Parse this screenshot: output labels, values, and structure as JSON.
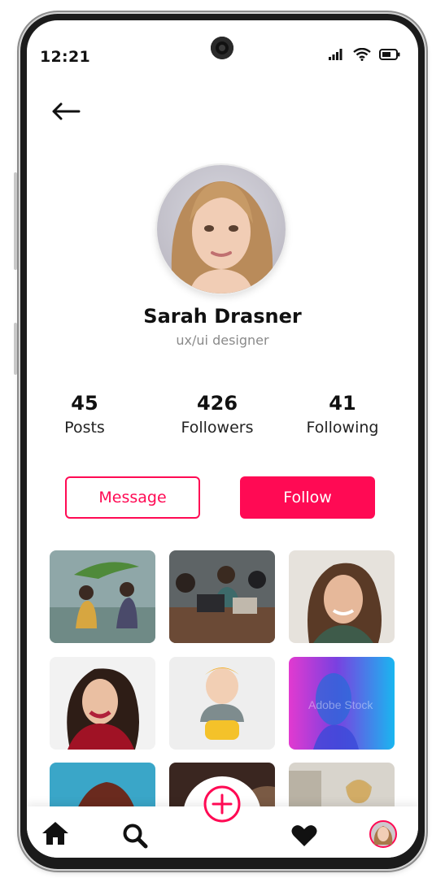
{
  "status_bar": {
    "time": "12:21",
    "icons": [
      "signal-icon",
      "wifi-icon",
      "battery-icon"
    ]
  },
  "header": {
    "back_icon": "arrow-left-icon"
  },
  "profile": {
    "name": "Sarah Drasner",
    "role": "ux/ui designer",
    "avatar_icon": "avatar"
  },
  "stats": [
    {
      "value": "45",
      "label": "Posts"
    },
    {
      "value": "426",
      "label": "Followers"
    },
    {
      "value": "41",
      "label": "Following"
    }
  ],
  "actions": {
    "message_label": "Message",
    "follow_label": "Follow"
  },
  "gallery": {
    "watermark": "Adobe Stock",
    "items": [
      "photo-girls-rain",
      "photo-team-laptop",
      "photo-curly-woman",
      "photo-red-sweater-woman",
      "photo-baby",
      "photo-neon-portrait",
      "photo-partial-1",
      "photo-partial-2",
      "photo-partial-3"
    ]
  },
  "bottom_nav": {
    "items": [
      "home-icon",
      "search-icon",
      "add-icon",
      "heart-icon",
      "profile-avatar"
    ]
  },
  "colors": {
    "accent": "#ff0a54",
    "text": "#111111",
    "muted": "#8a8a8a"
  }
}
